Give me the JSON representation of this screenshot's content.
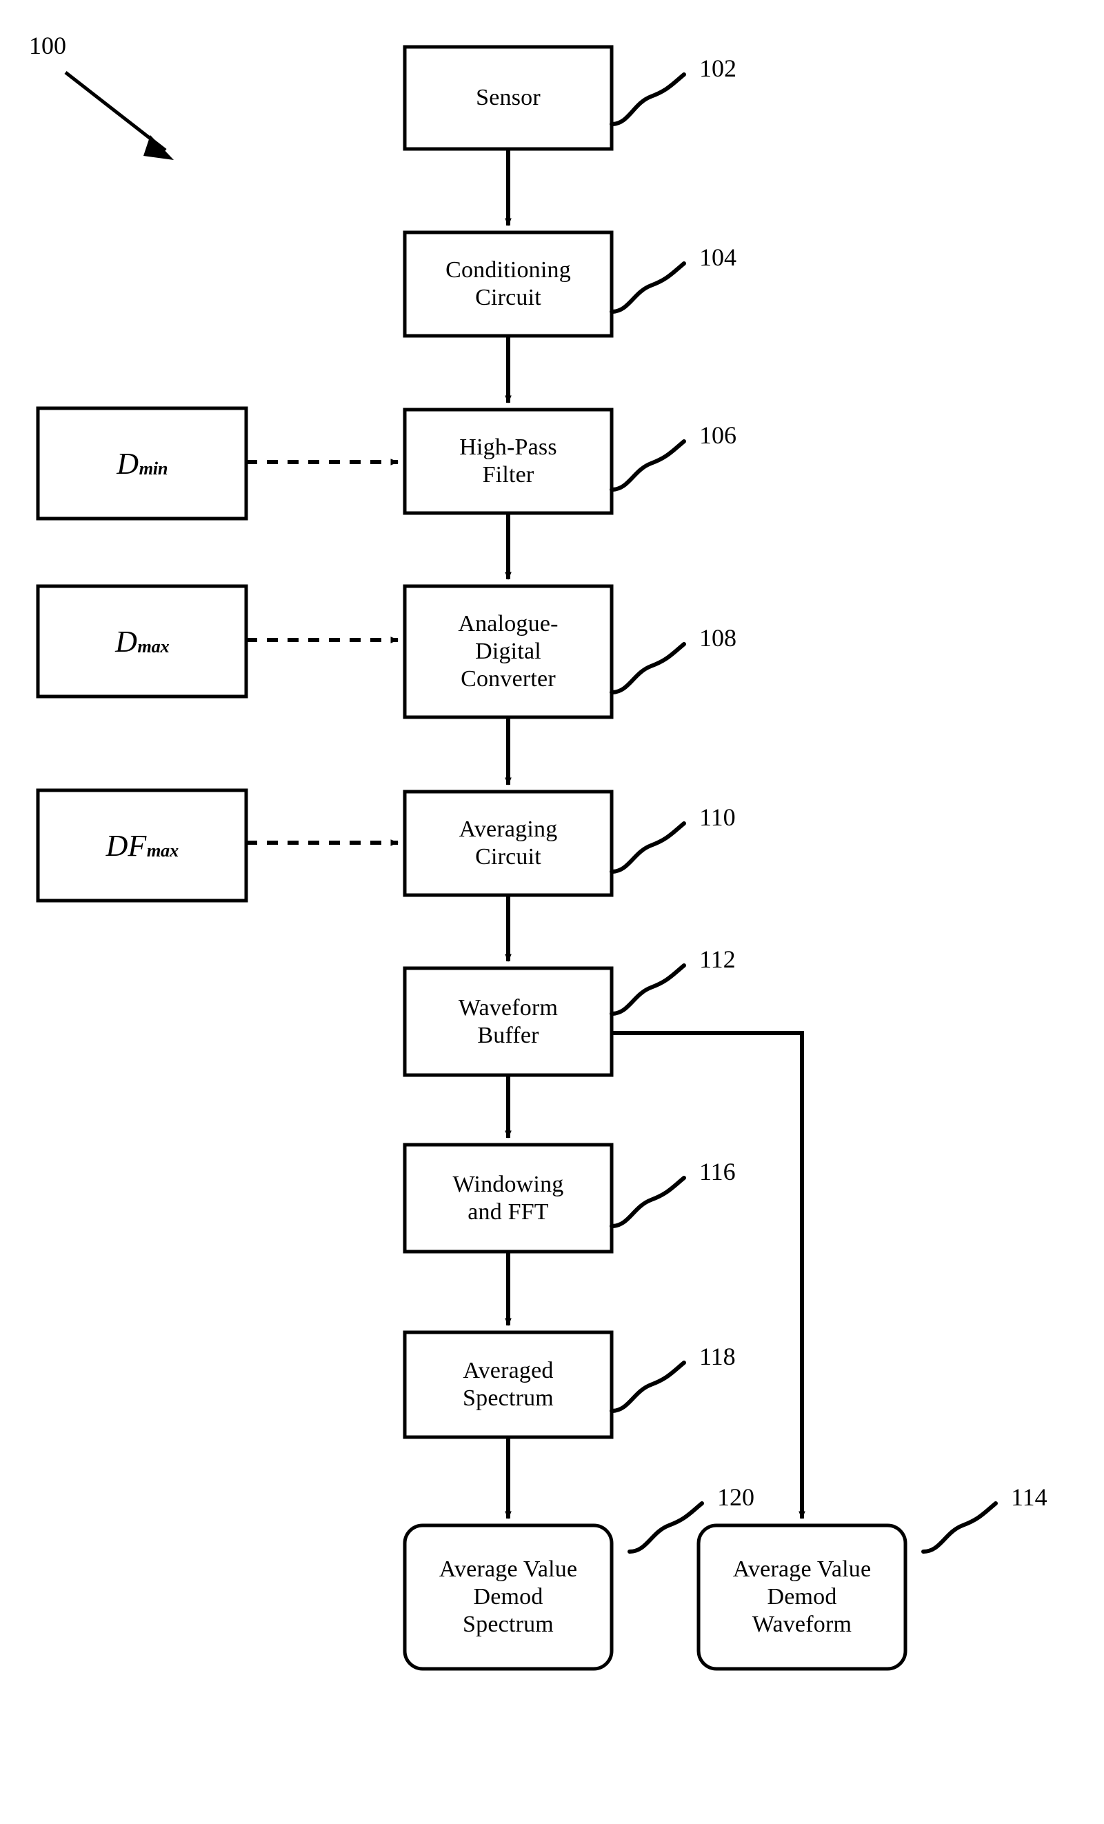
{
  "figure": {
    "id_label": "100",
    "background_color": "#ffffff",
    "line_color": "#000000"
  },
  "process_blocks": [
    {
      "key": "sensor",
      "ref": "102",
      "lines": [
        "Sensor"
      ]
    },
    {
      "key": "conditioning",
      "ref": "104",
      "lines": [
        "Conditioning",
        "Circuit"
      ]
    },
    {
      "key": "highpass",
      "ref": "106",
      "lines": [
        "High-Pass",
        "Filter"
      ]
    },
    {
      "key": "adc",
      "ref": "108",
      "lines": [
        "Analogue-",
        "Digital",
        "Converter"
      ]
    },
    {
      "key": "averaging",
      "ref": "110",
      "lines": [
        "Averaging",
        "Circuit"
      ]
    },
    {
      "key": "wavebuffer",
      "ref": "112",
      "lines": [
        "Waveform",
        "Buffer"
      ]
    },
    {
      "key": "windowfft",
      "ref": "116",
      "lines": [
        "Windowing",
        "and FFT"
      ]
    },
    {
      "key": "avgspectrum",
      "ref": "118",
      "lines": [
        "Averaged",
        "Spectrum"
      ]
    }
  ],
  "output_blocks": [
    {
      "key": "demod_spectrum",
      "ref": "120",
      "lines": [
        "Average Value",
        "Demod",
        "Spectrum"
      ]
    },
    {
      "key": "demod_waveform",
      "ref": "114",
      "lines": [
        "Average Value",
        "Demod",
        "Waveform"
      ]
    }
  ],
  "parameter_blocks": [
    {
      "key": "dmin",
      "base": "D",
      "sub": "min",
      "target": "highpass"
    },
    {
      "key": "dmax",
      "base": "D",
      "sub": "max",
      "target": "adc"
    },
    {
      "key": "dfmax",
      "base": "DF",
      "sub": "max",
      "target": "averaging"
    }
  ]
}
